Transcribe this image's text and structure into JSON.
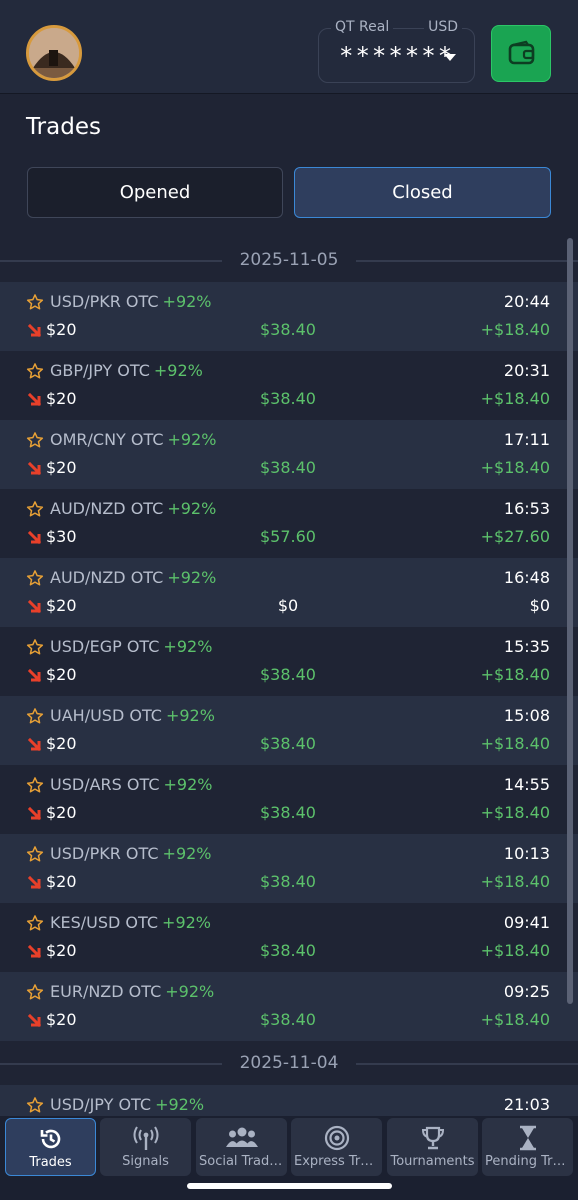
{
  "header": {
    "account_type": "QT Real",
    "currency": "USD",
    "balance_masked": "*******"
  },
  "page": {
    "title": "Trades",
    "tabs": [
      {
        "label": "Opened",
        "active": false
      },
      {
        "label": "Closed",
        "active": true
      }
    ]
  },
  "groups": [
    {
      "date": "2025-11-05",
      "trades": [
        {
          "pair": "USD/PKR OTC",
          "percent": "+92%",
          "time": "20:44",
          "amount": "$20",
          "payout": "$38.40",
          "profit": "+$18.40"
        },
        {
          "pair": "GBP/JPY OTC",
          "percent": "+92%",
          "time": "20:31",
          "amount": "$20",
          "payout": "$38.40",
          "profit": "+$18.40"
        },
        {
          "pair": "OMR/CNY OTC",
          "percent": "+92%",
          "time": "17:11",
          "amount": "$20",
          "payout": "$38.40",
          "profit": "+$18.40"
        },
        {
          "pair": "AUD/NZD OTC",
          "percent": "+92%",
          "time": "16:53",
          "amount": "$30",
          "payout": "$57.60",
          "profit": "+$27.60"
        },
        {
          "pair": "AUD/NZD OTC",
          "percent": "+92%",
          "time": "16:48",
          "amount": "$20",
          "payout": "$0",
          "profit": "$0"
        },
        {
          "pair": "USD/EGP OTC",
          "percent": "+92%",
          "time": "15:35",
          "amount": "$20",
          "payout": "$38.40",
          "profit": "+$18.40"
        },
        {
          "pair": "UAH/USD OTC",
          "percent": "+92%",
          "time": "15:08",
          "amount": "$20",
          "payout": "$38.40",
          "profit": "+$18.40"
        },
        {
          "pair": "USD/ARS OTC",
          "percent": "+92%",
          "time": "14:55",
          "amount": "$20",
          "payout": "$38.40",
          "profit": "+$18.40"
        },
        {
          "pair": "USD/PKR OTC",
          "percent": "+92%",
          "time": "10:13",
          "amount": "$20",
          "payout": "$38.40",
          "profit": "+$18.40"
        },
        {
          "pair": "KES/USD OTC",
          "percent": "+92%",
          "time": "09:41",
          "amount": "$20",
          "payout": "$38.40",
          "profit": "+$18.40"
        },
        {
          "pair": "EUR/NZD OTC",
          "percent": "+92%",
          "time": "09:25",
          "amount": "$20",
          "payout": "$38.40",
          "profit": "+$18.40"
        }
      ]
    },
    {
      "date": "2025-11-04",
      "trades": [
        {
          "pair": "USD/JPY OTC",
          "percent": "+92%",
          "time": "21:03",
          "amount": "",
          "payout": "",
          "profit": ""
        }
      ]
    }
  ],
  "nav": {
    "items": [
      {
        "label": "Trades",
        "icon": "history-icon",
        "active": true
      },
      {
        "label": "Signals",
        "icon": "signal-tower-icon",
        "active": false
      },
      {
        "label": "Social Trading",
        "icon": "users-icon",
        "active": false
      },
      {
        "label": "Express Trades",
        "icon": "target-icon",
        "active": false
      },
      {
        "label": "Tournaments",
        "icon": "trophy-icon",
        "active": false
      },
      {
        "label": "Pending Trades",
        "icon": "hourglass-icon",
        "active": false
      }
    ]
  },
  "colors": {
    "background": "#1f2434",
    "accent_blue": "#3b88d6",
    "profit_green": "#5cc16b",
    "down_arrow": "#e8402a",
    "star": "#e7a036",
    "wallet_green": "#1aa452"
  }
}
